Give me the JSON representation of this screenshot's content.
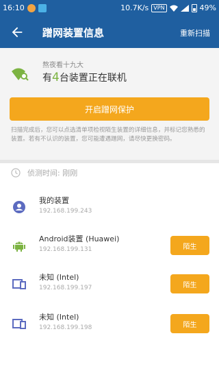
{
  "status_bar": {
    "time": "16:10",
    "speed": "10.7K/s",
    "vpn": "VPN",
    "battery": "49%"
  },
  "app_bar": {
    "title": "蹭网装置信息",
    "action": "重新扫描"
  },
  "network": {
    "name": "熬夜看十九大",
    "online_prefix": "有",
    "online_count": "4",
    "online_suffix": "台装置正在联机"
  },
  "protect_button": "开启蹭网保护",
  "description": "扫描完成后，您可以点选清单项检视陌生装置的详细信息，并标记您熟悉的装置。若有不认识的装置，您可能遭遇蹭网，请尽快更换密码。",
  "scan": {
    "label": "侦测时间:",
    "value": "刚刚"
  },
  "devices": [
    {
      "name": "我的装置",
      "ip": "192.168.199.243",
      "icon": "user-icon",
      "tag": ""
    },
    {
      "name": "Android装置 (Huawei)",
      "ip": "192.168.199.131",
      "icon": "android-icon",
      "tag": "陌生"
    },
    {
      "name": "未知 (Intel)",
      "ip": "192.168.199.197",
      "icon": "devices-icon",
      "tag": "陌生"
    },
    {
      "name": "未知 (Intel)",
      "ip": "192.168.199.198",
      "icon": "devices-icon",
      "tag": "陌生"
    }
  ],
  "colors": {
    "primary": "#1f5fa0",
    "accent": "#f4a71d",
    "green": "#7cb342",
    "device_icon": "#5c6bc0"
  }
}
